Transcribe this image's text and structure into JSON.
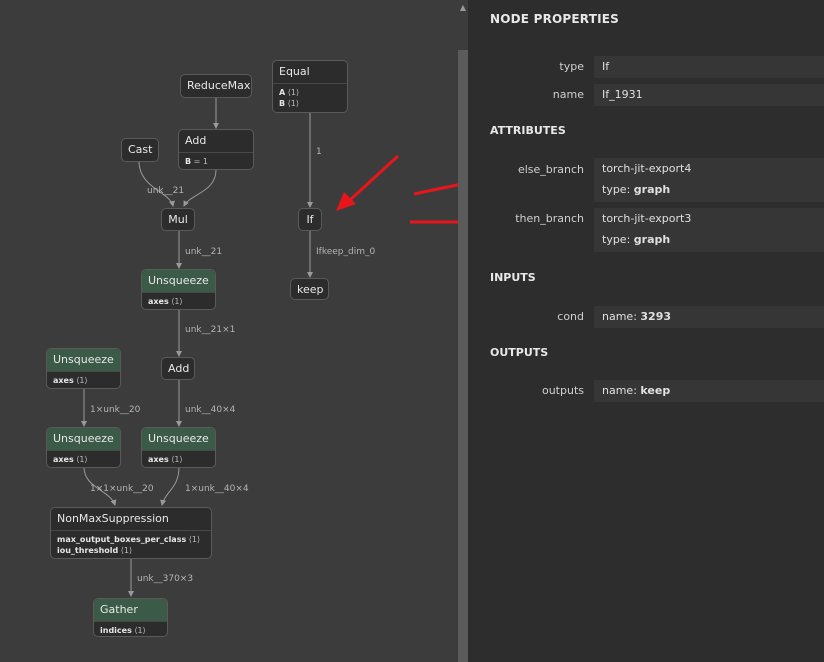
{
  "graph": {
    "nodes": {
      "reducemax": {
        "title": "ReduceMax"
      },
      "equal": {
        "title": "Equal",
        "attrs": [
          {
            "name": "A",
            "value": "⟨1⟩"
          },
          {
            "name": "B",
            "value": "⟨1⟩"
          }
        ]
      },
      "cast": {
        "title": "Cast"
      },
      "add1": {
        "title": "Add",
        "attrs": [
          {
            "name": "B",
            "value": "= 1"
          }
        ]
      },
      "mul": {
        "title": "Mul"
      },
      "if": {
        "title": "If"
      },
      "keep": {
        "title": "keep"
      },
      "unsq1": {
        "title": "Unsqueeze",
        "attrs": [
          {
            "name": "axes",
            "value": "⟨1⟩"
          }
        ]
      },
      "add2": {
        "title": "Add"
      },
      "unsq_l1": {
        "title": "Unsqueeze",
        "attrs": [
          {
            "name": "axes",
            "value": "⟨1⟩"
          }
        ]
      },
      "unsq_l2": {
        "title": "Unsqueeze",
        "attrs": [
          {
            "name": "axes",
            "value": "⟨1⟩"
          }
        ]
      },
      "unsq_r": {
        "title": "Unsqueeze",
        "attrs": [
          {
            "name": "axes",
            "value": "⟨1⟩"
          }
        ]
      },
      "nms": {
        "title": "NonMaxSuppression",
        "attrs": [
          {
            "name": "max_output_boxes_per_class",
            "value": "⟨1⟩"
          },
          {
            "name": "iou_threshold",
            "value": "⟨1⟩"
          }
        ]
      },
      "gather": {
        "title": "Gather",
        "attrs": [
          {
            "name": "indices",
            "value": "⟨1⟩"
          }
        ]
      }
    },
    "edge_labels": {
      "equal_if": "1",
      "cast_mul": "unk__21",
      "mul_unsq": "unk__21",
      "if_keep": "Ifkeep_dim_0",
      "unsq_add": "unk__21×1",
      "ul1_ul2": "1×unk__20",
      "add_ur": "unk__40×4",
      "ul2_nms": "1×1×unk__20",
      "ur_nms": "1×unk__40×4",
      "nms_gather": "unk__370×3"
    }
  },
  "panel": {
    "title": "NODE PROPERTIES",
    "type_label": "type",
    "type_value": "If",
    "name_label": "name",
    "name_value": "If_1931",
    "attributes_title": "ATTRIBUTES",
    "else_label": "else_branch",
    "else_value": "torch-jit-export4",
    "else_type_key": "type:",
    "else_type_value": "graph",
    "then_label": "then_branch",
    "then_value": "torch-jit-export3",
    "then_type_key": "type:",
    "then_type_value": "graph",
    "inputs_title": "INPUTS",
    "cond_label": "cond",
    "cond_key": "name:",
    "cond_value": "3293",
    "outputs_title": "OUTPUTS",
    "outputs_label": "outputs",
    "outputs_key": "name:",
    "outputs_value": "keep"
  },
  "colors": {
    "annotation_arrow": "#e8151b",
    "graph_bg": "#3c3c3c",
    "panel_bg": "#2d2d2d",
    "node_green": "#3b5a48"
  },
  "icons": {
    "scroll_up": "triangle-up-icon"
  }
}
